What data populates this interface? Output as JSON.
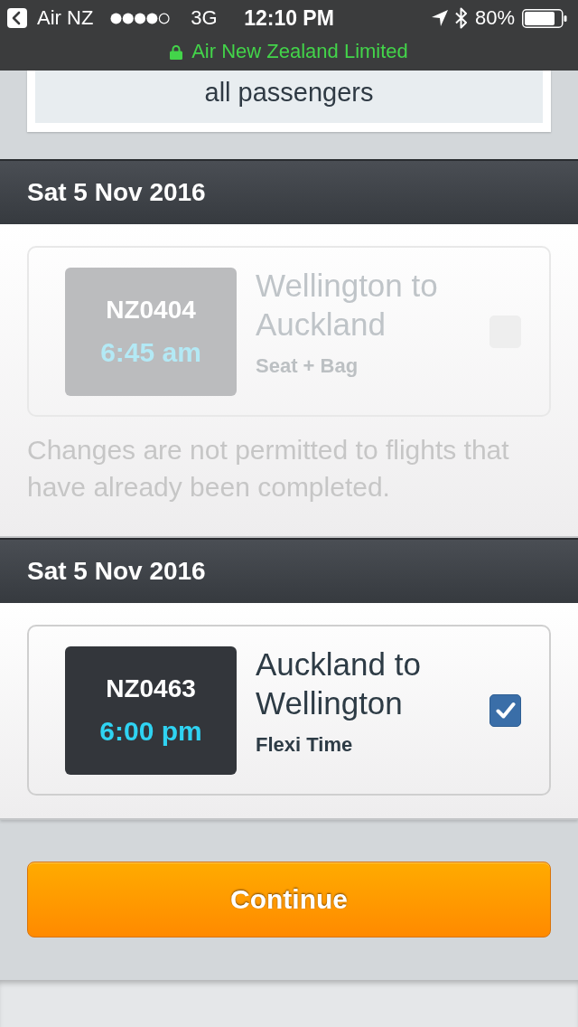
{
  "status_bar": {
    "back_label": "Air NZ",
    "network": "3G",
    "time": "12:10 PM",
    "battery": "80%"
  },
  "secure_site": {
    "label": "Air New Zealand Limited"
  },
  "notice_card": {
    "text": "all passengers"
  },
  "sections": [
    {
      "date": "Sat 5 Nov 2016",
      "flight": {
        "number": "NZ0404",
        "time": "6:45 am",
        "route": "Wellington to Auckland",
        "fare": "Seat + Bag",
        "disabled": true,
        "checked": false
      },
      "note": "Changes are not permitted to flights that have already been completed."
    },
    {
      "date": "Sat 5 Nov 2016",
      "flight": {
        "number": "NZ0463",
        "time": "6:00 pm",
        "route": "Auckland to Wellington",
        "fare": "Flexi Time",
        "disabled": false,
        "checked": true
      }
    }
  ],
  "continue_button": {
    "label": "Continue"
  }
}
